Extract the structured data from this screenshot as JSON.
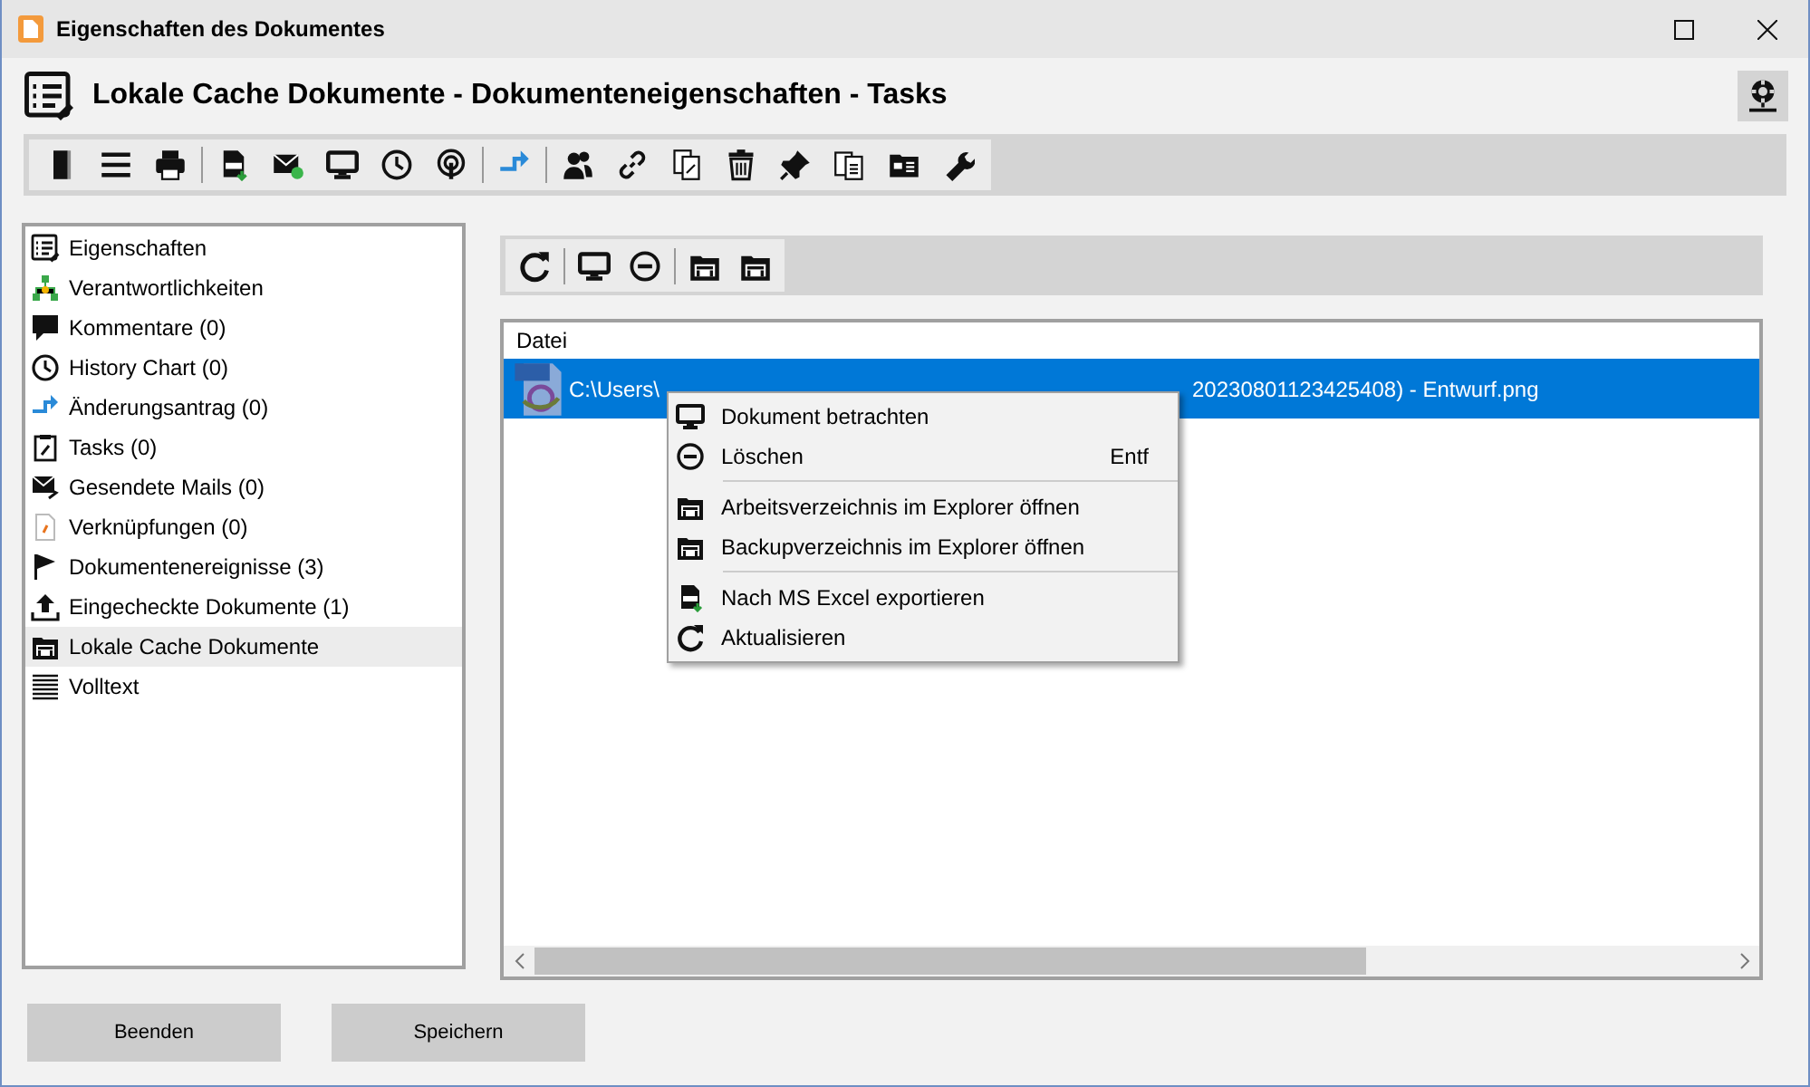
{
  "window": {
    "title": "Eigenschaften des Dokumentes"
  },
  "header": {
    "title": "Lokale Cache Dokumente - Dokumenteneigenschaften - Tasks"
  },
  "sidebar": {
    "items": [
      {
        "label": "Eigenschaften",
        "selected": false
      },
      {
        "label": "Verantwortlichkeiten",
        "selected": false
      },
      {
        "label": "Kommentare (0)",
        "selected": false
      },
      {
        "label": "History Chart (0)",
        "selected": false
      },
      {
        "label": "Änderungsantrag (0)",
        "selected": false
      },
      {
        "label": "Tasks (0)",
        "selected": false
      },
      {
        "label": "Gesendete Mails (0)",
        "selected": false
      },
      {
        "label": "Verknüpfungen (0)",
        "selected": false
      },
      {
        "label": "Dokumentenereignisse (3)",
        "selected": false
      },
      {
        "label": "Eingecheckte Dokumente (1)",
        "selected": false
      },
      {
        "label": "Lokale Cache Dokumente",
        "selected": true
      },
      {
        "label": "Volltext",
        "selected": false
      }
    ]
  },
  "file_list": {
    "columns": [
      "Datei"
    ],
    "rows": [
      {
        "selected": true,
        "visible_start": "C:\\Users\\",
        "visible_end": "20230801123425408) - Entwurf.png"
      }
    ]
  },
  "context_menu": {
    "items": [
      {
        "kind": "item",
        "label": "Dokument betrachten"
      },
      {
        "kind": "item",
        "label": "Löschen",
        "shortcut": "Entf"
      },
      {
        "kind": "separator"
      },
      {
        "kind": "item",
        "label": "Arbeitsverzeichnis im Explorer öffnen"
      },
      {
        "kind": "item",
        "label": "Backupverzeichnis im Explorer öffnen"
      },
      {
        "kind": "separator"
      },
      {
        "kind": "item",
        "label": "Nach MS Excel exportieren"
      },
      {
        "kind": "item",
        "label": "Aktualisieren"
      }
    ]
  },
  "buttons": [
    "Beenden",
    "Speichern"
  ]
}
